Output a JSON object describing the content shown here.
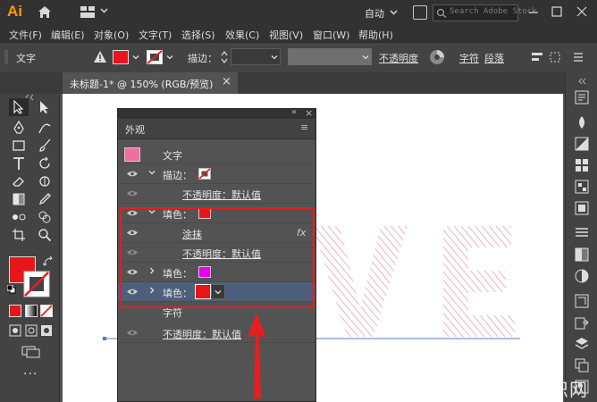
{
  "app": {
    "logo": "Ai",
    "workspace": "自动",
    "search_placeholder": "Search Adobe Stock"
  },
  "menu": [
    "文件(F)",
    "编辑(E)",
    "对象(O)",
    "文字(T)",
    "选择(S)",
    "效果(C)",
    "视图(V)",
    "窗口(W)",
    "帮助(H)"
  ],
  "control": {
    "type_label": "文字",
    "stroke_label": "描边：",
    "opacity_label": "不透明度",
    "char_label": "字符",
    "para_label": "段落"
  },
  "doc_tab": {
    "title": "未标题-1* @ 150% (RGB/预览)",
    "close": "×"
  },
  "panel": {
    "title": "外观",
    "collapse": "«",
    "close": "×",
    "menu": "≡",
    "rows": [
      {
        "label": "文字"
      },
      {
        "label": "描边："
      },
      {
        "label": "不透明度：默认值"
      },
      {
        "label": "填色："
      },
      {
        "label": "涂抹",
        "fx": "fx"
      },
      {
        "label": "不透明度：默认值"
      },
      {
        "label": "填色："
      },
      {
        "label": "填色："
      },
      {
        "label": "字符"
      },
      {
        "label": "不透明度：默认值"
      }
    ]
  },
  "canvas_text": "VE",
  "colors": {
    "fill_red": "#e8151b",
    "fill_magenta": "#e800e8",
    "artwork_pink": "#e3a2b8",
    "highlight": "#e61e1e",
    "selected_row": "#4e5f7b"
  },
  "watermark": "爱创根知识网"
}
